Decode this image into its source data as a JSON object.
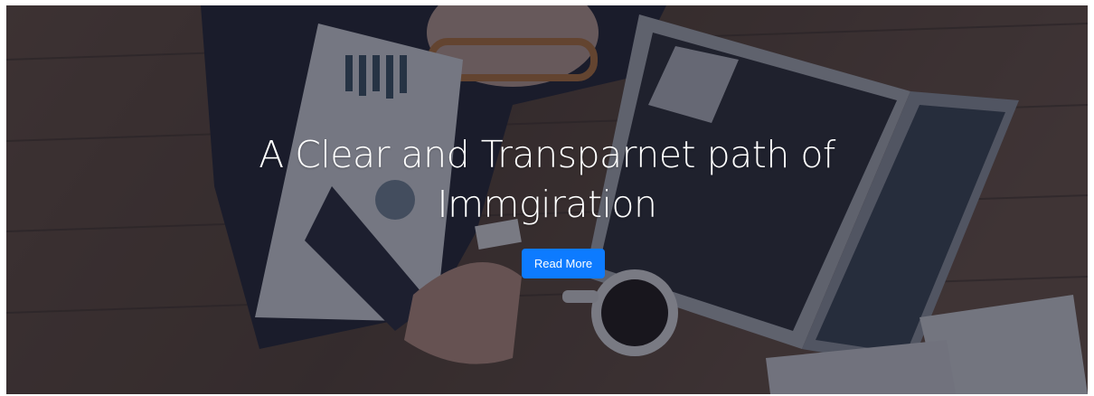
{
  "hero": {
    "title": "A Clear and Transparnet path of Immgiration",
    "button_label": "Read More"
  },
  "colors": {
    "button": "#0d7bff",
    "overlay": "#161828",
    "wood": "#5a4433"
  }
}
